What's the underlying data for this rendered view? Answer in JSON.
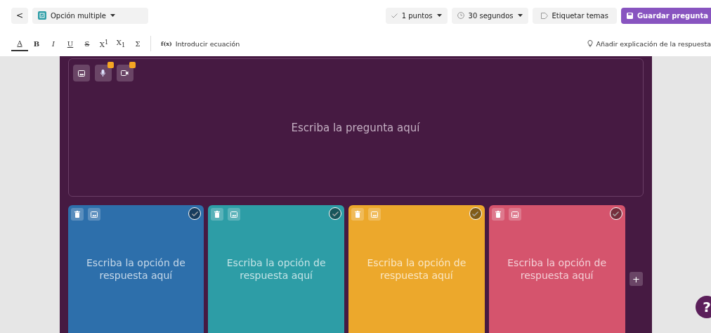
{
  "header": {
    "back_button": "<",
    "question_type": {
      "label": "Opción multiple"
    },
    "points": {
      "label": "1 puntos"
    },
    "time": {
      "label": "30 segundos"
    },
    "tag_button": {
      "label": "Etiquetar temas"
    },
    "save_button": {
      "label": "Guardar pregunta"
    }
  },
  "format_toolbar": {
    "buttons": [
      {
        "label": "A",
        "selected": true
      },
      {
        "label": "B",
        "selected": false
      },
      {
        "label": "I",
        "selected": false
      },
      {
        "label": "U",
        "selected": false
      },
      {
        "label": "S",
        "selected": false
      },
      {
        "label": "X$^{1}$",
        "selected": false
      },
      {
        "label": "X$_{1}$",
        "selected": false
      },
      {
        "label": "Σ",
        "selected": false
      }
    ],
    "equation_button": {
      "icon": "f(x)",
      "label": "Introducir ecuación"
    },
    "explanation_button": {
      "label": "Añadir explicación de la respuesta"
    }
  },
  "question": {
    "placeholder": "Escriba la pregunta aquí",
    "media_buttons": [
      {
        "kind": "image",
        "premium": false
      },
      {
        "kind": "audio",
        "premium": true
      },
      {
        "kind": "video",
        "premium": true
      }
    ]
  },
  "options": [
    {
      "placeholder": "Escriba la opción de respuesta aquí",
      "color": "#2d6fab",
      "correct": false
    },
    {
      "placeholder": "Escriba la opción de respuesta aquí",
      "color": "#2d9da6",
      "correct": false
    },
    {
      "placeholder": "Escriba la opción de respuesta aquí",
      "color": "#eca82c",
      "correct": false
    },
    {
      "placeholder": "Escriba la opción de respuesta aquí",
      "color": "#d5546d",
      "correct": false
    }
  ],
  "add_option_button": "+",
  "help_button": "?"
}
